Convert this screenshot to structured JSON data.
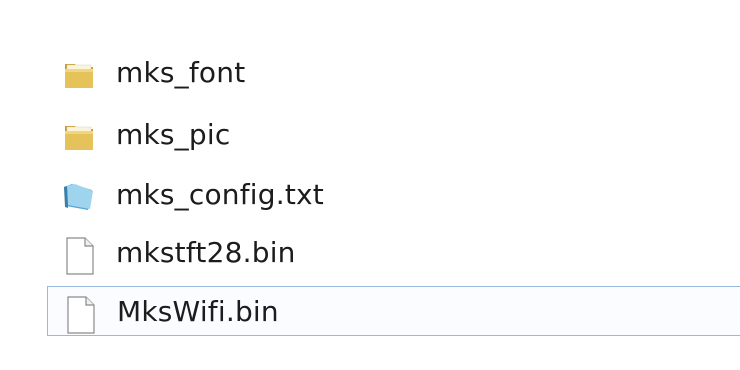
{
  "files": [
    {
      "name": "mks_font",
      "icon": "folder-icon"
    },
    {
      "name": "mks_pic",
      "icon": "folder-icon"
    },
    {
      "name": "mks_config.txt",
      "icon": "text-file-icon"
    },
    {
      "name": "mkstft28.bin",
      "icon": "blank-file-icon"
    },
    {
      "name": "MksWifi.bin",
      "icon": "blank-file-icon",
      "selected": true
    }
  ],
  "colors": {
    "folder": "#e6c25a",
    "folder_dark": "#c99a2e",
    "text_file": "#7dc3e8",
    "selection_border": "#9ab7de"
  }
}
